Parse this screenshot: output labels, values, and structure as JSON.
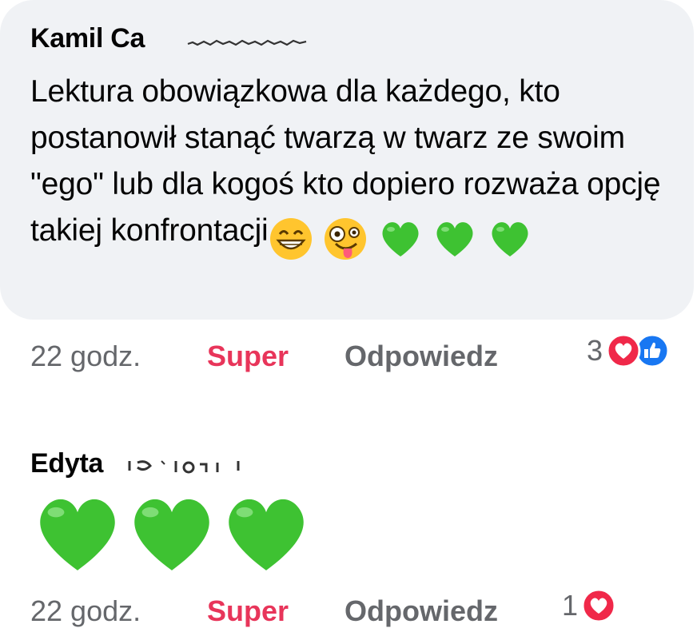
{
  "comments": [
    {
      "author": "Kamil Ca",
      "text": "Lektura obowiązkowa dla każdego, kto postanowił stanąć twarzą w twarz ze swoim \"ego\" lub dla kogoś kto dopiero rozważa opcję takiej konfrontacji",
      "emojis": [
        "beaming-face-icon",
        "zany-face-icon",
        "green-heart-icon",
        "green-heart-icon",
        "green-heart-icon"
      ],
      "time": "22 godz.",
      "reaction_label": "Super",
      "reply_label": "Odpowiedz",
      "reaction_count": "3",
      "reaction_icons": [
        "love-reaction-icon",
        "like-reaction-icon"
      ]
    },
    {
      "author": "Edyta",
      "emojis": [
        "green-heart-icon",
        "green-heart-icon",
        "green-heart-icon"
      ],
      "time": "22 godz.",
      "reaction_label": "Super",
      "reply_label": "Odpowiedz",
      "reaction_count": "1",
      "reaction_icons": [
        "love-reaction-icon"
      ]
    }
  ],
  "colors": {
    "bubble_bg": "#f0f2f5",
    "super_red": "#e8355a",
    "meta_gray": "#65676b",
    "heart_green": "#3ec232",
    "love_red": "#f02849",
    "like_blue": "#1877f2"
  }
}
